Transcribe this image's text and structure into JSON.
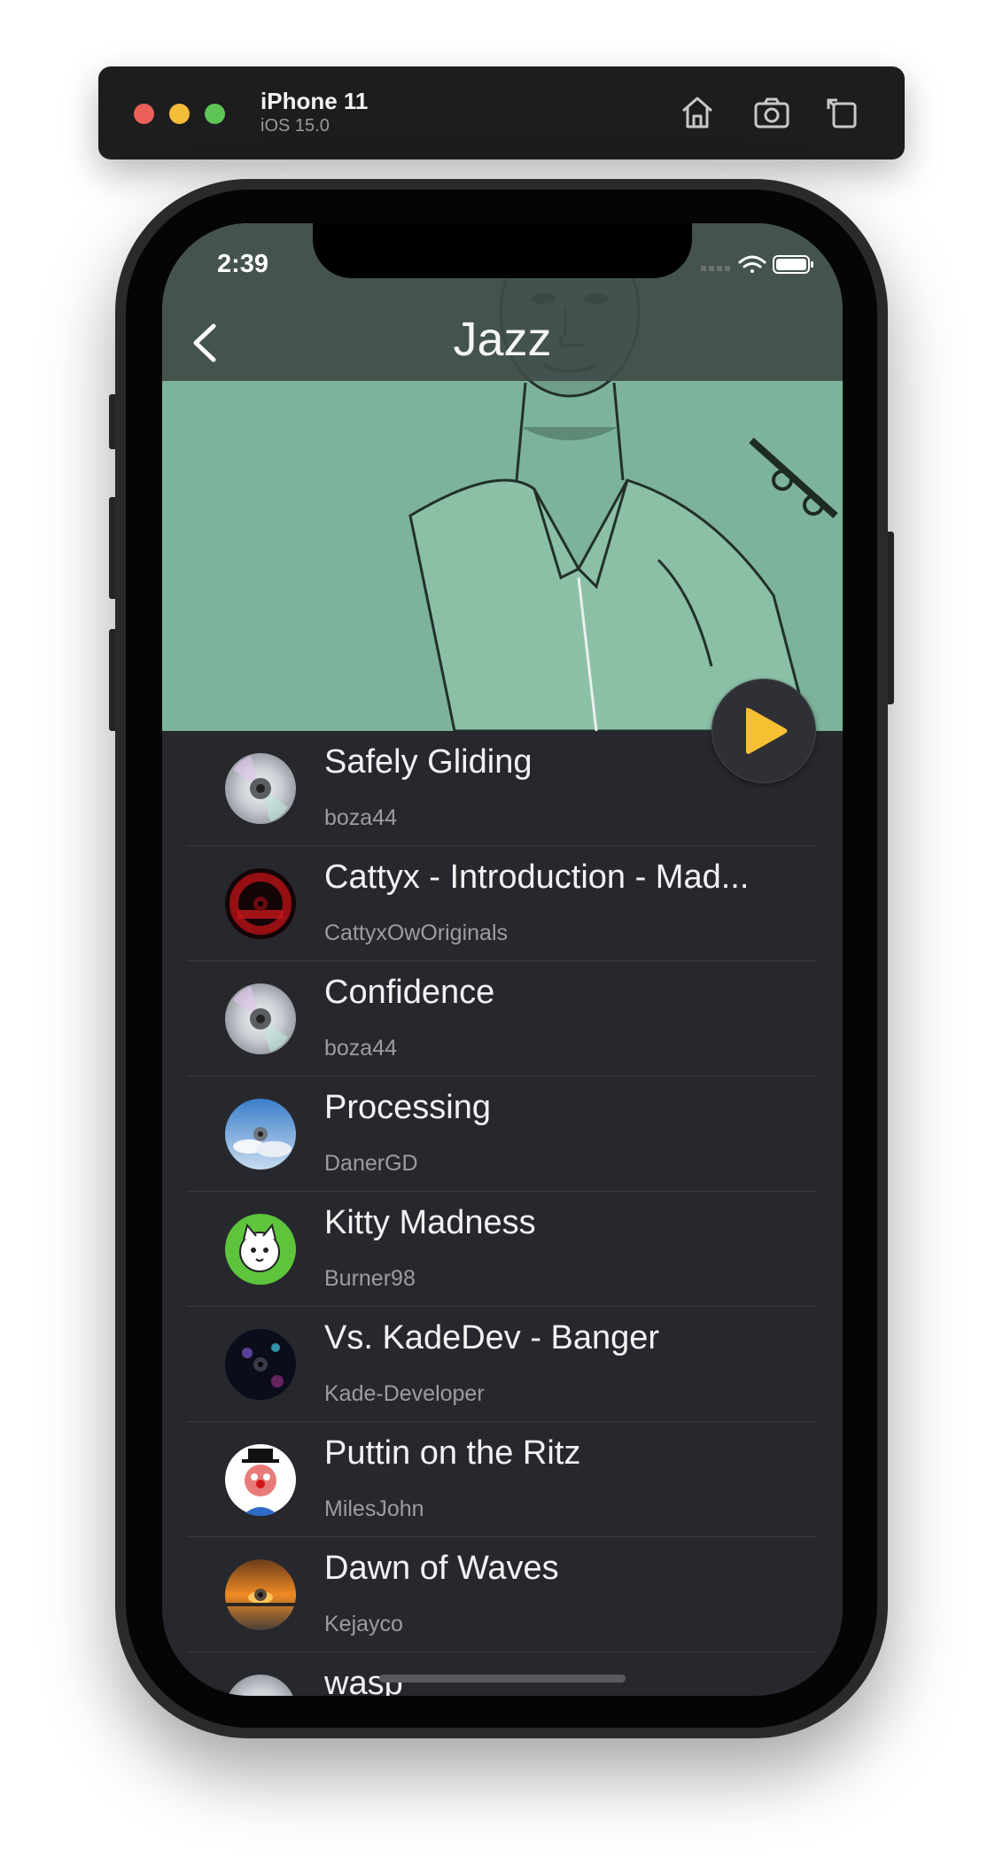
{
  "simulator": {
    "device_name": "iPhone 11",
    "os_version": "iOS 15.0",
    "icons": [
      "home-icon",
      "screenshot-icon",
      "rotate-icon"
    ]
  },
  "status_bar": {
    "time": "2:39"
  },
  "nav": {
    "title": "Jazz",
    "back_icon": "chevron-left-icon"
  },
  "colors": {
    "header_art": "#7db39a",
    "nav_band": "#3f4c46",
    "list_bg": "#27282e",
    "play_accent": "#f6c032"
  },
  "tracks": [
    {
      "title": "Safely Gliding",
      "artist": "boza44",
      "art": "cd-icon"
    },
    {
      "title": "Cattyx - Introduction - Mad...",
      "artist": "CattyxOwOriginals",
      "art": "album-art-red"
    },
    {
      "title": "Confidence",
      "artist": "boza44",
      "art": "cd-icon"
    },
    {
      "title": "Processing",
      "artist": "DanerGD",
      "art": "album-art-sky"
    },
    {
      "title": "Kitty Madness",
      "artist": "Burner98",
      "art": "album-art-cat"
    },
    {
      "title": "Vs. KadeDev - Banger",
      "artist": "Kade-Developer",
      "art": "album-art-dark"
    },
    {
      "title": "Puttin on the Ritz",
      "artist": "MilesJohn",
      "art": "album-art-clown"
    },
    {
      "title": "Dawn of Waves",
      "artist": "Kejayco",
      "art": "album-art-sunset"
    },
    {
      "title": "wasp",
      "artist": "",
      "art": "cd-icon"
    }
  ]
}
